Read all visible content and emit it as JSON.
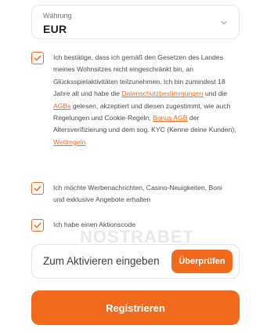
{
  "currency": {
    "label": "Währung",
    "value": "EUR"
  },
  "terms": {
    "checked": true,
    "text_1": "Ich bestätige, dass ich gemäß den Gesetzen des Landes meines Wohnsitzes nicht eingeschränkt bin, an Glücksspielaktivitäten teilzunehmen. Ich bin zumindest 18 Jahre alt und habe die ",
    "link_privacy": "Datenschutzbestimmungen",
    "text_2": " und die ",
    "link_agb": "AGBs",
    "text_3": " gelesen, akzeptiert und diesen zugestimmt, wie auch Regelungen und Cookie-Regeln, ",
    "link_bonus_agb": "Bonus AGB",
    "text_4": " der Altersverifizierung und dem sog. KYC (Kenne deine Kunden), ",
    "link_wettregeln": "Wettregeln"
  },
  "newsletter": {
    "checked": true,
    "text": "Ich möchte Werbenachrichten, Casino-Neuigkeiten, Boni und exklusive Angebote erhalten"
  },
  "promo_toggle": {
    "checked": true,
    "text": "Ich habe einen Aktionscode"
  },
  "promo": {
    "placeholder": "Zum Aktivieren eingeben",
    "check_button": "Überprüfen"
  },
  "watermark": "NOSTRABET",
  "register_button": "Registrieren",
  "colors": {
    "accent": "#f26a1b",
    "border": "#e3e3e3"
  },
  "icons": {
    "currency_dropdown": "chevron-down-icon",
    "checkbox": "checkmark-icon"
  }
}
